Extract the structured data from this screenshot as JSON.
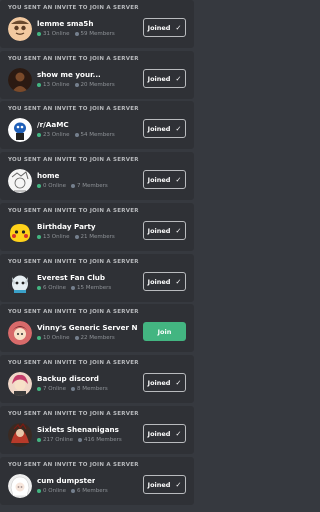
{
  "invites": [
    {
      "header": "YOU SENT AN INVITE TO JOIN A SERVER",
      "name": "lemme sma5h",
      "online": "31 Online",
      "members": "59 Members",
      "button": "Joined",
      "joined": true,
      "avatar_icon": "cartoon-face-avatar",
      "colors": {
        "bg": "#f2c9a0",
        "fg": "#5a3b24"
      }
    },
    {
      "header": "YOU SENT AN INVITE TO JOIN A SERVER",
      "name": "show me your...",
      "online": "13 Online",
      "members": "20 Members",
      "button": "Joined",
      "joined": true,
      "avatar_icon": "dark-figure-avatar",
      "colors": {
        "bg": "#2b1a12",
        "fg": "#7a4a2a"
      }
    },
    {
      "header": "YOU SENT AN INVITE TO JOIN A SERVER",
      "name": "/r/AaMC",
      "online": "23 Online",
      "members": "54 Members",
      "button": "Joined",
      "joined": true,
      "avatar_icon": "mascot-avatar",
      "colors": {
        "bg": "#ffffff",
        "fg": "#1f5fb8"
      }
    },
    {
      "header": "YOU SENT AN INVITE TO JOIN A SERVER",
      "name": "home",
      "online": "0 Online",
      "members": "7 Members",
      "button": "Joined",
      "joined": true,
      "avatar_icon": "manga-sketch-avatar",
      "colors": {
        "bg": "#f5f5f5",
        "fg": "#666666"
      }
    },
    {
      "header": "YOU SENT AN INVITE TO JOIN A SERVER",
      "name": "Birthday Party",
      "online": "13 Online",
      "members": "21 Members",
      "button": "Joined",
      "joined": true,
      "avatar_icon": "yellow-creature-avatar",
      "colors": {
        "bg": "#ffd21a",
        "fg": "#d9342b"
      }
    },
    {
      "header": "YOU SENT AN INVITE TO JOIN A SERVER",
      "name": "Everest Fan Club",
      "online": "6 Online",
      "members": "15 Members",
      "button": "Joined",
      "joined": true,
      "avatar_icon": "white-dog-avatar",
      "colors": {
        "bg": "#e6eef2",
        "fg": "#3aa0c8"
      }
    },
    {
      "header": "YOU SENT AN INVITE TO JOIN A SERVER",
      "name": "Vinny's Generic Server Name",
      "online": "10 Online",
      "members": "22 Members",
      "button": "Join",
      "joined": false,
      "avatar_icon": "anime-character-avatar",
      "colors": {
        "bg": "#d86a6a",
        "fg": "#f7e1c8"
      }
    },
    {
      "header": "YOU SENT AN INVITE TO JOIN A SERVER",
      "name": "Backup discord",
      "online": "7 Online",
      "members": "8 Members",
      "button": "Joined",
      "joined": true,
      "avatar_icon": "pink-character-avatar",
      "colors": {
        "bg": "#f0d7c8",
        "fg": "#c43e6b"
      }
    },
    {
      "header": "YOU SENT AN INVITE TO JOIN A SERVER",
      "name": "Sixlets Shenanigans",
      "online": "217 Online",
      "members": "416 Members",
      "button": "Joined",
      "joined": true,
      "avatar_icon": "red-character-avatar",
      "colors": {
        "bg": "#3a2a22",
        "fg": "#b83a2a"
      }
    },
    {
      "header": "YOU SENT AN INVITE TO JOIN A SERVER",
      "name": "cum dumpster",
      "online": "0 Online",
      "members": "6 Members",
      "button": "Joined",
      "joined": true,
      "avatar_icon": "white-hair-avatar",
      "colors": {
        "bg": "#eeeeee",
        "fg": "#9a8a8a"
      }
    }
  ],
  "check_glyph": "✓"
}
